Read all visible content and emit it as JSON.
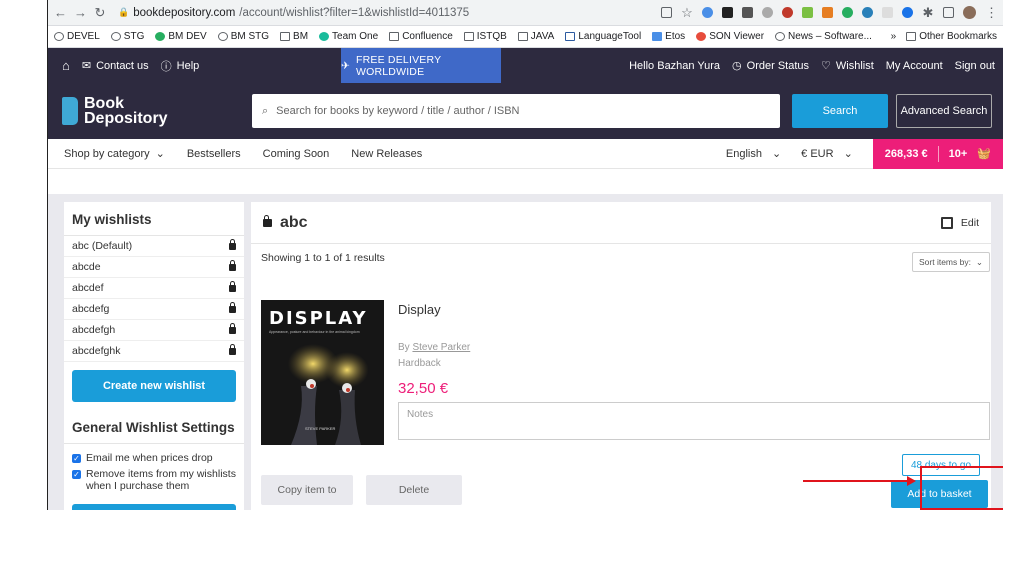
{
  "browser": {
    "url_host": "bookdepository.com",
    "url_path": "/account/wishlist?filter=1&wishlistId=4011375",
    "bookmarks": [
      "DEVEL",
      "STG",
      "BM DEV",
      "BM STG",
      "BM",
      "Team One",
      "Confluence",
      "ISTQB",
      "JAVA",
      "LanguageTool",
      "Etos",
      "SON Viewer",
      "News – Software..."
    ],
    "bookmarks_more": "»",
    "other_bookmarks": "Other Bookmarks"
  },
  "topstrip": {
    "contact": "Contact us",
    "help": "Help",
    "free_delivery": "FREE DELIVERY WORLDWIDE",
    "greeting": "Hello Bazhan Yura",
    "order_status": "Order Status",
    "wishlist": "Wishlist",
    "my_account": "My Account",
    "sign_out": "Sign out"
  },
  "header": {
    "logo_line1": "Book",
    "logo_line2": "Depository",
    "search_placeholder": "Search for books by keyword / title / author / ISBN",
    "search_button": "Search",
    "advanced_search": "Advanced Search"
  },
  "catbar": {
    "shop_by_category": "Shop by category",
    "bestsellers": "Bestsellers",
    "coming_soon": "Coming Soon",
    "new_releases": "New Releases",
    "language": "English",
    "currency": "€ EUR",
    "basket_total": "268,33 €",
    "basket_count": "10+"
  },
  "sidebar": {
    "title": "My wishlists",
    "items": [
      {
        "label": "abc (Default)"
      },
      {
        "label": "abcde"
      },
      {
        "label": "abcdef"
      },
      {
        "label": "abcdefg"
      },
      {
        "label": "abcdefgh"
      },
      {
        "label": "abcdefghk"
      }
    ],
    "create_button": "Create new wishlist"
  },
  "settings": {
    "title": "General Wishlist Settings",
    "email_price_drop": "Email me when prices drop",
    "remove_items": "Remove items from my wishlists when I purchase them"
  },
  "main": {
    "wishlist_title": "abc",
    "edit": "Edit",
    "results": "Showing 1 to 1 of 1 results",
    "sort_label": "Sort items by:",
    "item": {
      "cover_title": "DISPLAY",
      "cover_subtitle": "Appearance, posture and behaviour in the animal kingdom",
      "cover_author": "STEVE PARKER",
      "title": "Display",
      "by_prefix": "By ",
      "author": "Steve Parker",
      "format": "Hardback",
      "price": "32,50 €",
      "notes_placeholder": "Notes",
      "days_to_go": "48 days to go",
      "copy_button": "Copy item to",
      "delete_button": "Delete",
      "add_to_basket": "Add to basket"
    }
  },
  "colors": {
    "brand_dark": "#2d2a3f",
    "accent_blue": "#1a9dd9",
    "price_pink": "#ed1e79",
    "annotation_red": "#e0141c"
  }
}
